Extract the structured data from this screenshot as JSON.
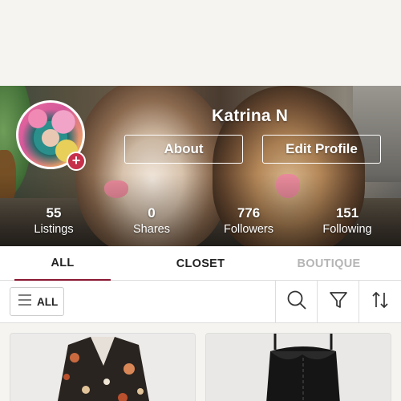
{
  "profile": {
    "name": "Katrina N",
    "avatar_badge": "+",
    "about_label": "About",
    "edit_label": "Edit Profile"
  },
  "stats": [
    {
      "value": "55",
      "label": "Listings"
    },
    {
      "value": "0",
      "label": "Shares"
    },
    {
      "value": "776",
      "label": "Followers"
    },
    {
      "value": "151",
      "label": "Following"
    }
  ],
  "tabs": [
    {
      "label": "ALL",
      "active": true
    },
    {
      "label": "CLOSET",
      "active": false
    },
    {
      "label": "BOUTIQUE",
      "active": false
    }
  ],
  "filter": {
    "category_label": "ALL",
    "icons": [
      "menu-icon",
      "search-icon",
      "filter-icon",
      "sort-icon"
    ]
  },
  "colors": {
    "accent": "#8a1731",
    "badge": "#c6304a",
    "inactive_tab": "#b5b5b5"
  },
  "listings": [
    {
      "image": "floral-print-vest"
    },
    {
      "image": "black-lace-bustier-dress"
    }
  ]
}
